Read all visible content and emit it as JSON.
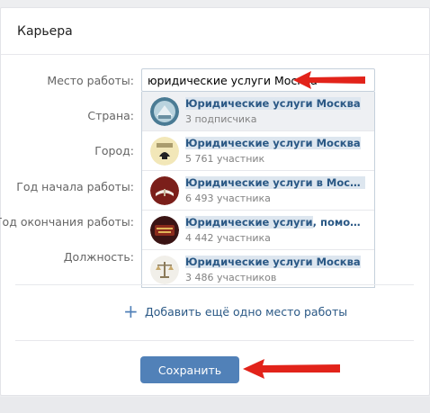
{
  "section": {
    "title": "Карьера"
  },
  "form": {
    "labels": {
      "workplace": "Место работы:",
      "country": "Страна:",
      "city": "Город:",
      "start_year": "Год начала работы:",
      "end_year": "Год окончания работы:",
      "position": "Должность:"
    },
    "workplace_value": "юридические услуги Москва"
  },
  "suggestions": [
    {
      "name_highlight": "Юридические услуги Москва",
      "name_rest": "",
      "subtitle": "3 подписчика"
    },
    {
      "name_highlight": "Юридические услуги Москва",
      "name_rest": "",
      "subtitle": "5 761 участник"
    },
    {
      "name_highlight": "Юридические услуги в Москве оплат...",
      "name_rest": "",
      "subtitle": "6 493 участника"
    },
    {
      "name_highlight": "Юридические услуги",
      "name_rest": ", помощь, юрис...",
      "subtitle": "4 442 участника"
    },
    {
      "name_highlight": "Юридические услуги Москва",
      "name_rest": "",
      "subtitle": "3 486 участников"
    }
  ],
  "actions": {
    "add_workplace": "Добавить ещё одно место работы",
    "save": "Сохранить"
  },
  "colors": {
    "accent": "#5181b8",
    "link": "#2a5885",
    "annotation_arrow": "#e2231a"
  }
}
